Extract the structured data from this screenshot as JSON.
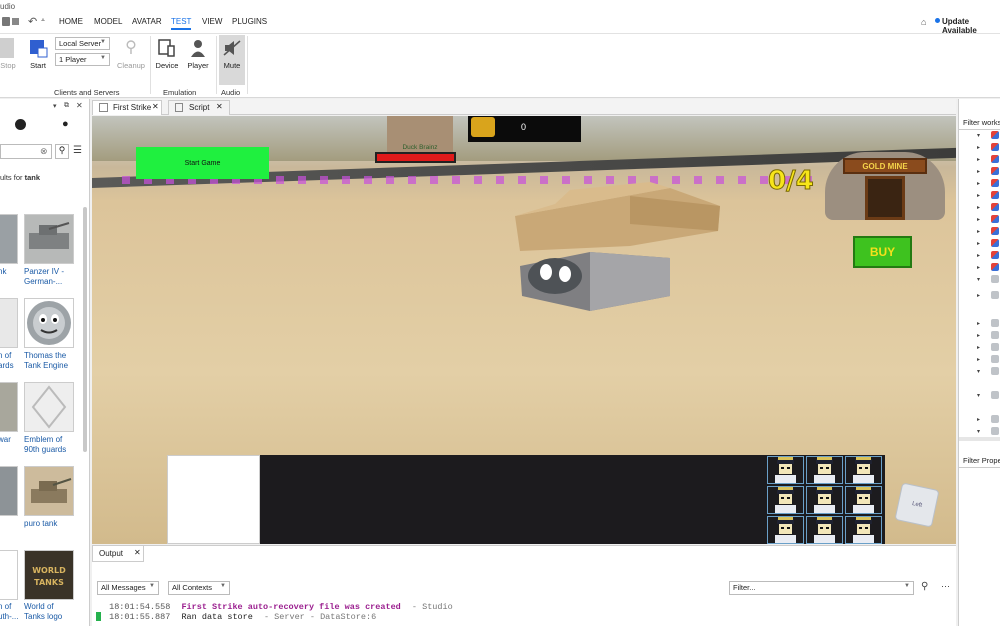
{
  "titlebar": {
    "app_title": "udio"
  },
  "menu": {
    "tabs": [
      "HOME",
      "MODEL",
      "AVATAR",
      "TEST",
      "VIEW",
      "PLUGINS"
    ],
    "active_tab": "TEST",
    "update_label": "Update Available"
  },
  "ribbon": {
    "stop_label": "Stop",
    "start_label": "Start",
    "server_select": "Local Server",
    "players_select": "1 Player",
    "cleanup_label": "Cleanup",
    "device_label": "Device",
    "player_label": "Player",
    "mute_label": "Mute",
    "group_clients": "Clients and Servers",
    "group_emulation": "Emulation",
    "group_audio": "Audio"
  },
  "toolbox": {
    "results_prefix": "ults for ",
    "results_query": "tank",
    "items": [
      {
        "label": "nk",
        "label2": ""
      },
      {
        "label": "Panzer IV -",
        "label2": "German-..."
      },
      {
        "label": "n of",
        "label2": "ards"
      },
      {
        "label": "Thomas the",
        "label2": "Tank Engine"
      },
      {
        "label": "war",
        "label2": ""
      },
      {
        "label": "Emblem of",
        "label2": "90th guards"
      },
      {
        "label": "",
        "label2": ""
      },
      {
        "label": "puro tank",
        "label2": ""
      },
      {
        "label": "n of",
        "label2": "uth-..."
      },
      {
        "label": "World of",
        "label2": "Tanks logo"
      }
    ]
  },
  "doc_tabs": [
    {
      "label": "First Strike"
    },
    {
      "label": "Script"
    }
  ],
  "game": {
    "start_button": "Start Game",
    "score": "0",
    "progress": "0/4",
    "gold_mine_label": "GOLD MINE",
    "buy_label": "BUY",
    "player_name": "Duck Brainz",
    "health_fraction": 1.0,
    "view_cube": "Left"
  },
  "output": {
    "tab_label": "Output",
    "messages_filter": "All Messages",
    "contexts_filter": "All Contexts",
    "filter_placeholder": "Filter...",
    "lines": [
      {
        "time": "18:01:54.558",
        "text": "First Strike auto-recovery file was created",
        "source": "-  Studio"
      },
      {
        "time": "18:01:55.887",
        "text": "Ran data store",
        "source": "-  Server - DataStore:6"
      }
    ]
  },
  "explorer": {
    "filter_label": "Filter works",
    "properties_label": "Filter Prope"
  }
}
